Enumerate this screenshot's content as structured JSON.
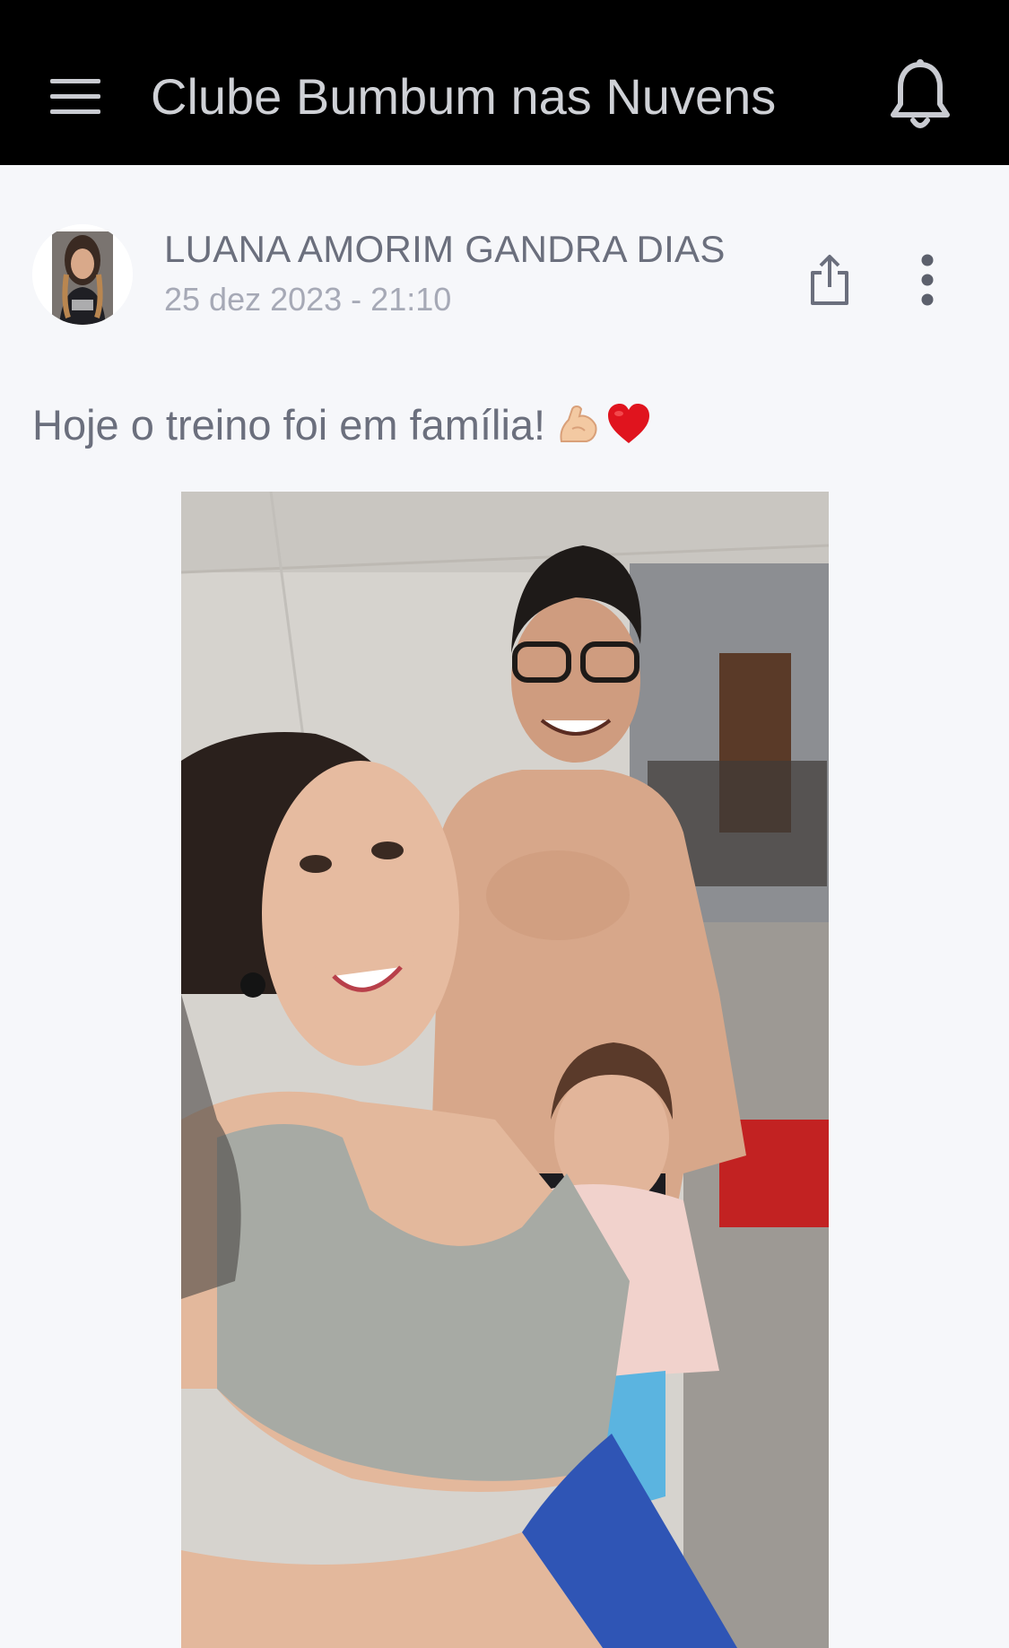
{
  "app": {
    "title": "Clube Bumbum nas Nuvens",
    "icons": {
      "menu": "hamburger-menu-icon",
      "notifications": "bell-icon"
    }
  },
  "post": {
    "author": "LUANA AMORIM GANDRA DIAS",
    "date": "25 dez 2023 - 21:10",
    "text": "Hoje o treino foi em família!",
    "emojis": [
      "flexed-biceps",
      "red-heart"
    ],
    "actions": {
      "share": "share-icon",
      "more": "more-vertical-icon"
    }
  },
  "colors": {
    "topbar_bg": "#000000",
    "topbar_text": "#cfd1d6",
    "page_bg": "#f6f7fa",
    "name_text": "#6b6f7d",
    "date_text": "#a6a9b6",
    "heart": "#e0141e"
  }
}
